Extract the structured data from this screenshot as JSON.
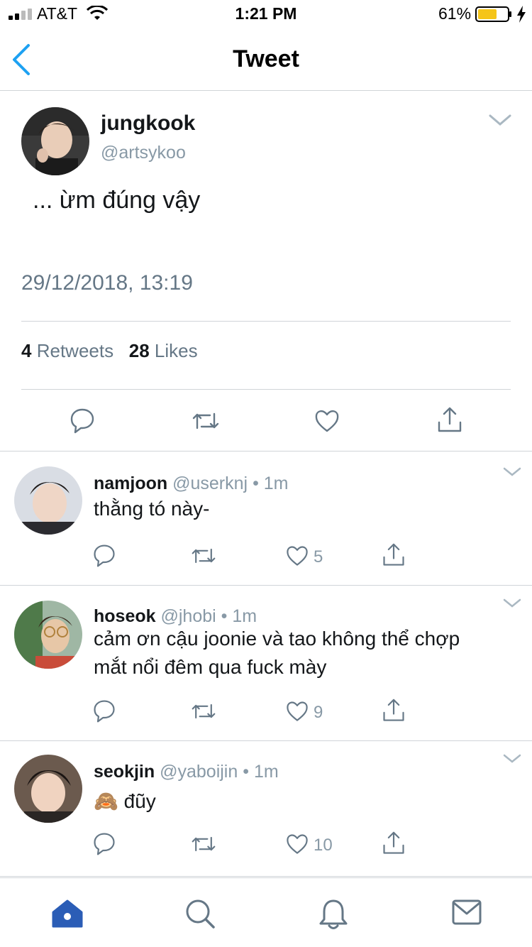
{
  "status_bar": {
    "carrier": "AT&T",
    "time": "1:21 PM",
    "battery": "61%"
  },
  "nav": {
    "title": "Tweet"
  },
  "tweet": {
    "name": "jungkook",
    "handle": "@artsykoo",
    "text": "... ừm đúng vậy",
    "date": "29/12/2018, 13:19",
    "retweets_count": "4",
    "retweets_label": "Retweets",
    "likes_count": "28",
    "likes_label": "Likes"
  },
  "replies": [
    {
      "name": "namjoon",
      "handle": "@userknj",
      "dot": "•",
      "time": "1m",
      "text": "thằng tó này-",
      "likes": "5"
    },
    {
      "name": "hoseok",
      "handle": "@jhobi",
      "dot": "•",
      "time": "1m",
      "text": "cảm ơn cậu joonie và tao không thể chợp mắt nổi đêm qua fuck mày",
      "likes": "9"
    },
    {
      "name": "seokjin",
      "handle": "@yaboijin",
      "dot": "•",
      "time": "1m",
      "text": "🙈 đũy",
      "likes": "10"
    }
  ],
  "colors": {
    "accent": "#1da1f2",
    "active_tab": "#2b5db6",
    "icon_gray": "#657786",
    "battery": "#f5c518"
  },
  "icons": [
    "back-chevron-icon",
    "chevron-down-icon",
    "reply-icon",
    "retweet-icon",
    "like-icon",
    "share-icon",
    "home-icon",
    "search-icon",
    "notifications-icon",
    "messages-icon"
  ]
}
